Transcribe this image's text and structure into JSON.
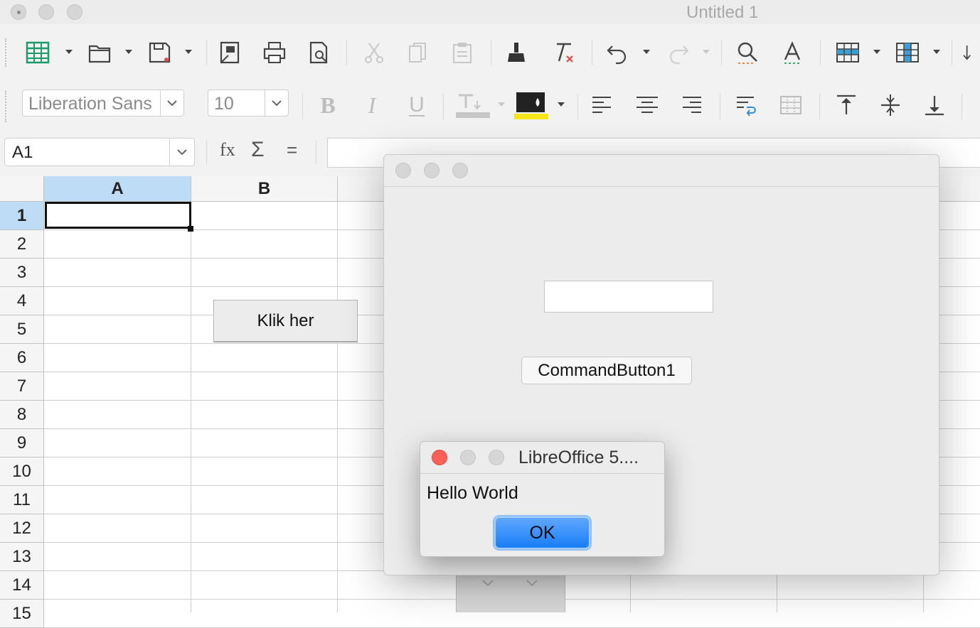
{
  "window": {
    "title": "Untitled 1"
  },
  "toolbar": {
    "font_name": "Liberation Sans",
    "font_size": "10",
    "icons": [
      "spreadsheet-icon",
      "open-icon",
      "save-icon",
      "export-pdf-icon",
      "print-icon",
      "print-preview-icon",
      "cut-icon",
      "copy-icon",
      "paste-icon",
      "clone-formatting-icon",
      "clear-formatting-icon",
      "undo-icon",
      "redo-icon",
      "find-replace-icon",
      "spelling-icon",
      "row-icon",
      "column-icon",
      "sort-icon"
    ],
    "format_icons": [
      "bold-icon",
      "italic-icon",
      "underline-icon",
      "font-color-icon",
      "highlight-color-icon",
      "align-left-icon",
      "align-center-icon",
      "align-right-icon",
      "wrap-text-icon",
      "merge-cells-icon",
      "align-top-icon",
      "center-vertically-icon",
      "align-bottom-icon"
    ],
    "highlight_color": "#f6e61a"
  },
  "formula_bar": {
    "name_box": "A1",
    "function_wizard": "fx",
    "sum_symbol": "Σ",
    "equals_symbol": "="
  },
  "sheet": {
    "columns": [
      "A",
      "B"
    ],
    "rows": [
      "1",
      "2",
      "3",
      "4",
      "5",
      "6",
      "7",
      "8",
      "9",
      "10",
      "11",
      "12",
      "13",
      "14",
      "15"
    ],
    "selected_cell": "A1",
    "button_label": "Klik her"
  },
  "form_dialog": {
    "command_button": "CommandButton1",
    "text_field_value": ""
  },
  "message_box": {
    "title": "LibreOffice 5....",
    "message": "Hello World",
    "ok_label": "OK"
  },
  "colors": {
    "accent_blue": "#1a7ef5",
    "selection_header": "#bfdcf7",
    "close_red": "#fc5f57"
  }
}
